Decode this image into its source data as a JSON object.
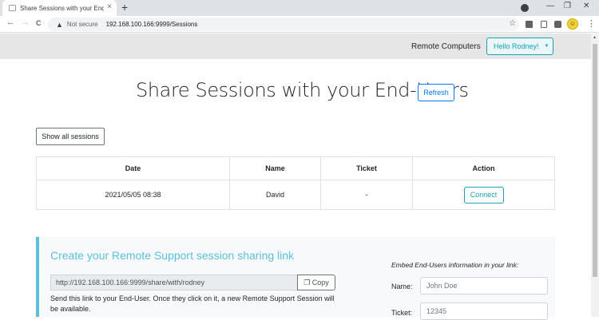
{
  "browser": {
    "tab_title": "Share Sessions with your End-Us",
    "tab_close": "×",
    "new_tab": "+",
    "window_controls": [
      "—",
      "❐",
      "✕"
    ],
    "back": "←",
    "forward": "→",
    "reload": "C",
    "security_icon": "▲",
    "not_secure": "Not secure",
    "url": "192.168.100.166:9999/Sessions",
    "star": "☆",
    "menu": "⋮"
  },
  "navbar": {
    "link": "Remote Computers",
    "user_button": "Hello Rodney!"
  },
  "main": {
    "heading": "Share Sessions with your End-Users",
    "refresh_label": "Refresh",
    "show_all_label": "Show all sessions",
    "table": {
      "headers": [
        "Date",
        "Name",
        "Ticket",
        "Action"
      ],
      "rows": [
        {
          "date": "2021/05/05 08:38",
          "name": "David",
          "ticket": "-",
          "action": "Connect"
        }
      ]
    }
  },
  "panel": {
    "title": "Create your Remote Support session sharing link",
    "link_value": "http://192.168.100.166:9999/share/with/rodney",
    "copy_label": "Copy",
    "info": "Send this link to your End-User. Once they click on it, a new Remote Support Session will be available.",
    "embed_label": "Embed End-Users information in your link:",
    "name_label": "Name:",
    "name_placeholder": "John Doe",
    "ticket_label": "Ticket:",
    "ticket_placeholder": "12345"
  },
  "colors": {
    "accent": "#17a2b8",
    "info": "#5bc0de",
    "primary": "#007bff"
  }
}
